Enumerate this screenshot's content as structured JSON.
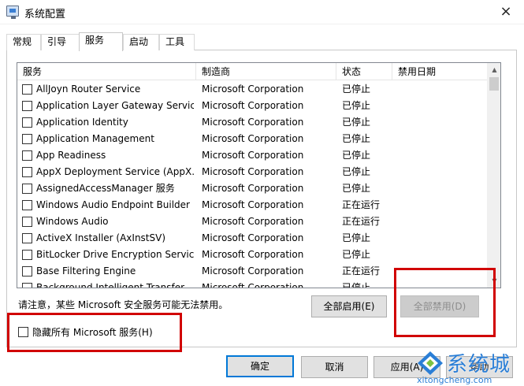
{
  "window": {
    "title": "系统配置",
    "close_glyph": "×"
  },
  "tabs": [
    {
      "label": "常规"
    },
    {
      "label": "引导"
    },
    {
      "label": "服务"
    },
    {
      "label": "启动"
    },
    {
      "label": "工具"
    }
  ],
  "active_tab": "服务",
  "columns": {
    "service": "服务",
    "manufacturer": "制造商",
    "status": "状态",
    "disabled_date": "禁用日期"
  },
  "services": [
    {
      "name": "AllJoyn Router Service",
      "manufacturer": "Microsoft Corporation",
      "status": "已停止"
    },
    {
      "name": "Application Layer Gateway Service",
      "manufacturer": "Microsoft Corporation",
      "status": "已停止"
    },
    {
      "name": "Application Identity",
      "manufacturer": "Microsoft Corporation",
      "status": "已停止"
    },
    {
      "name": "Application Management",
      "manufacturer": "Microsoft Corporation",
      "status": "已停止"
    },
    {
      "name": "App Readiness",
      "manufacturer": "Microsoft Corporation",
      "status": "已停止"
    },
    {
      "name": "AppX Deployment Service (AppX...",
      "manufacturer": "Microsoft Corporation",
      "status": "已停止"
    },
    {
      "name": "AssignedAccessManager 服务",
      "manufacturer": "Microsoft Corporation",
      "status": "已停止"
    },
    {
      "name": "Windows Audio Endpoint Builder",
      "manufacturer": "Microsoft Corporation",
      "status": "正在运行"
    },
    {
      "name": "Windows Audio",
      "manufacturer": "Microsoft Corporation",
      "status": "正在运行"
    },
    {
      "name": "ActiveX Installer (AxInstSV)",
      "manufacturer": "Microsoft Corporation",
      "status": "已停止"
    },
    {
      "name": "BitLocker Drive Encryption Service",
      "manufacturer": "Microsoft Corporation",
      "status": "已停止"
    },
    {
      "name": "Base Filtering Engine",
      "manufacturer": "Microsoft Corporation",
      "status": "正在运行"
    },
    {
      "name": "Background Intelligent Transfer...",
      "manufacturer": "Microsoft Corporation",
      "status": "已停止"
    }
  ],
  "notice": "请注意，某些 Microsoft 安全服务可能无法禁用。",
  "buttons": {
    "enable_all": "全部启用(E)",
    "disable_all": "全部禁用(D)",
    "ok": "确定",
    "cancel": "取消",
    "apply": "应用(A)",
    "help": "帮助"
  },
  "hide_ms_label": "隐藏所有 Microsoft 服务(H)",
  "scroll": {
    "up": "▲",
    "down": "▼"
  },
  "watermark": {
    "text": "系统城",
    "url": "xitongcheng.com"
  },
  "colors": {
    "highlight": "#d10000",
    "accent": "#0078d7",
    "watermark": "#2a7ed6"
  }
}
